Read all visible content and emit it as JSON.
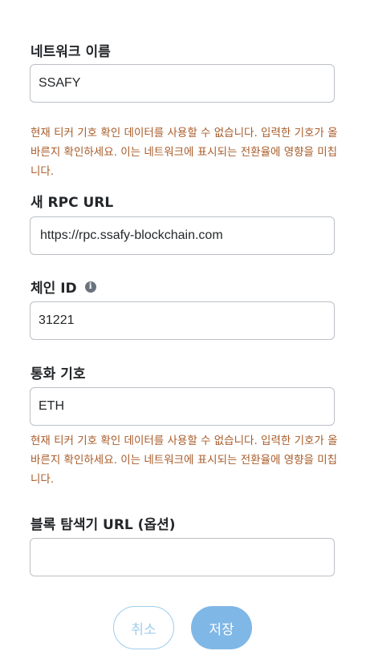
{
  "form": {
    "network_name": {
      "label": "네트워크 이름",
      "value": "SSAFY"
    },
    "network_name_warning": "현재 티커 기호 확인 데이터를 사용할 수 없습니다. 입력한 기호가 올바른지 확인하세요. 이는 네트워크에 표시되는 전환율에 영향을 미칩니다.",
    "rpc_url": {
      "label": "새 RPC URL",
      "value": "https://rpc.ssafy-blockchain.com"
    },
    "chain_id": {
      "label": "체인 ID",
      "info_icon_glyph": "i",
      "value": "31221"
    },
    "currency_symbol": {
      "label": "통화 기호",
      "value": "ETH"
    },
    "currency_symbol_warning": "현재 티커 기호 확인 데이터를 사용할 수 없습니다. 입력한 기호가 올바른지 확인하세요. 이는 네트워크에 표시되는 전환율에 영향을 미칩니다.",
    "block_explorer": {
      "label": "블록 탐색기 URL (옵션)",
      "value": ""
    }
  },
  "buttons": {
    "cancel_label": "취소",
    "save_label": "저장"
  },
  "colors": {
    "warning": "#a85c2a",
    "primary": "#7fb7e6",
    "border": "#bbc0c5"
  }
}
